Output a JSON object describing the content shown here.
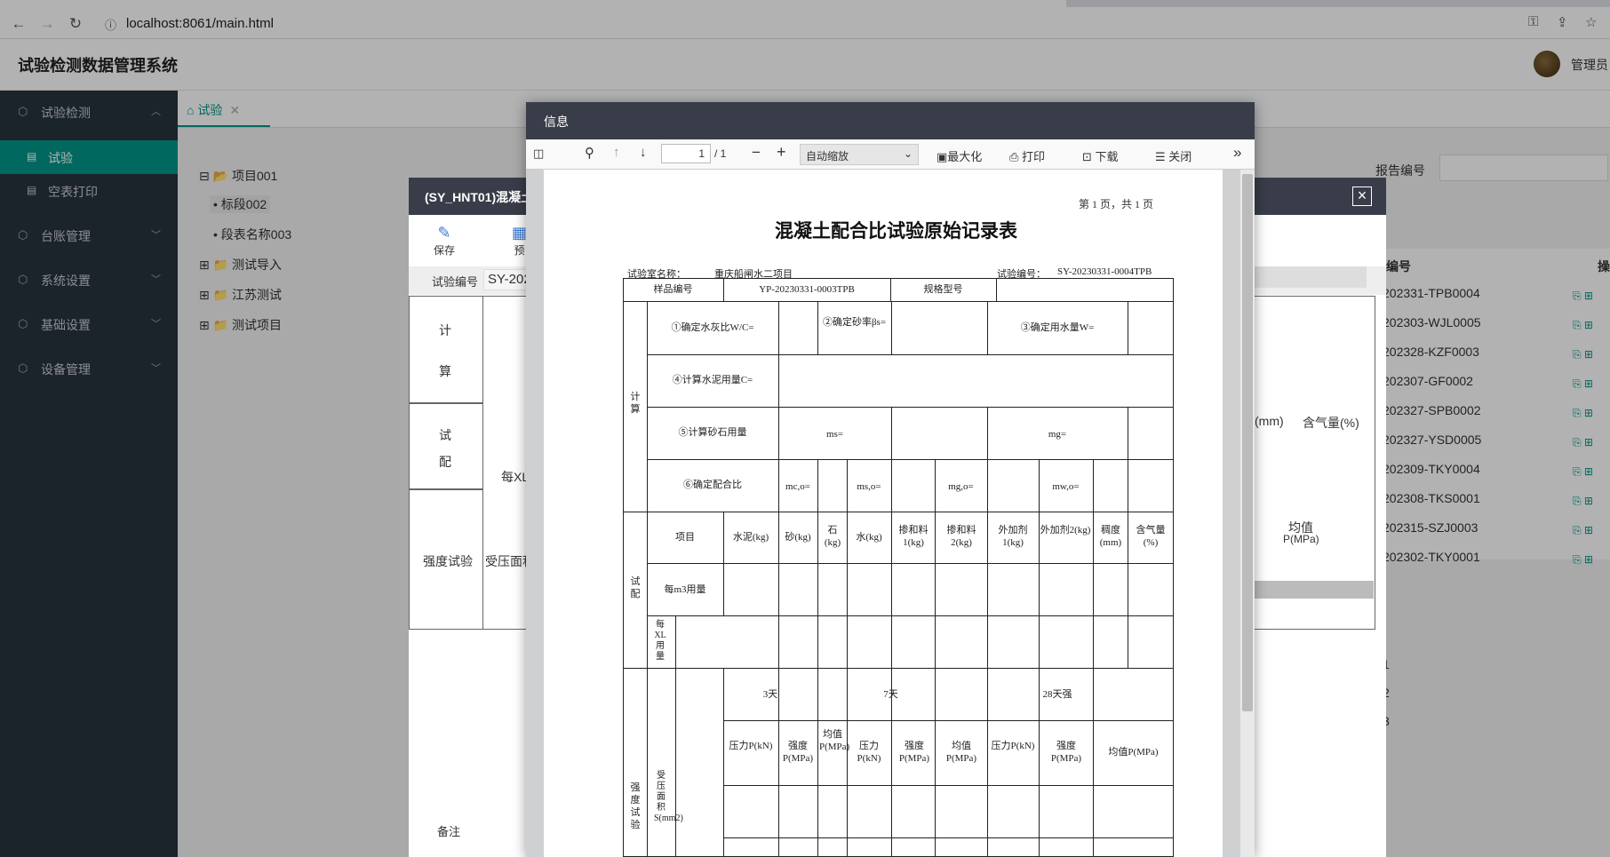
{
  "browser": {
    "url": "localhost:8061/main.html"
  },
  "header": {
    "title": "试验检测数据管理系统",
    "user": "管理员"
  },
  "sidebar": {
    "items": [
      {
        "label": "试验检测"
      },
      {
        "label": "台账管理"
      },
      {
        "label": "系统设置"
      },
      {
        "label": "基础设置"
      },
      {
        "label": "设备管理"
      }
    ],
    "sub": [
      {
        "label": "试验"
      },
      {
        "label": "空表打印"
      }
    ]
  },
  "content": {
    "tab": "试验",
    "tree": [
      "项目001",
      "标段002",
      "段表名称003",
      "测试导入",
      "江苏测试",
      "测试项目"
    ],
    "report_label": "报告编号",
    "col_no": "编号",
    "col_op": "操",
    "rows": [
      "202331-TPB0004",
      "202303-WJL0005",
      "202328-KZF0003",
      "202307-GF0002",
      "202327-SPB0002",
      "202327-YSD0005",
      "202309-TKY0004",
      "202308-TKS0001",
      "202315-SZJ0003",
      "202302-TKY0001"
    ],
    "right_vals": [
      "1",
      "2",
      "3"
    ]
  },
  "dialog": {
    "title": "(SY_HNT01)混凝土",
    "save": "保存",
    "preview": "预",
    "test_no_label": "试验编号",
    "test_no": "SY-202",
    "sec_calc_1": "计",
    "sec_calc_2": "算",
    "sec_mix_1": "试",
    "sec_mix_2": "配",
    "per_xl": "每XL",
    "strength": "强度试验",
    "pressure_area": "受压面积",
    "slump_mm": "(mm)",
    "air_content": "含气量(%)",
    "avg_p": "均值",
    "avg_p_unit": "P(MPa)",
    "remark": "备注"
  },
  "pdf": {
    "title": "信息",
    "page": "1",
    "page_total": "/ 1",
    "zoom": "自动缩放",
    "maximize": "最大化",
    "print": "打印",
    "download": "下载",
    "close": "关闭"
  },
  "form": {
    "pageno": "第 1 页，共 1 页",
    "title": "混凝土配合比试验原始记录表",
    "lab_label": "试验室名称：",
    "lab": "重庆船闸水二项目",
    "testno_label": "试验编号：",
    "testno": "SY-20230331-0004TPB",
    "sample_label": "样品编号",
    "sample": "YP-20230331-0003TPB",
    "spec_label": "规格型号",
    "calc": "计算",
    "r1a": "①确定水灰比W/C=",
    "r1b": "②确定砂率βs=",
    "r1c": "③确定用水量W=",
    "r2": "④计算水泥用量C=",
    "r3": "⑤计算砂石用量",
    "ms": "ms=",
    "mg": "mg=",
    "r4": "⑥确定配合比",
    "mc": "mc,o=",
    "ms0": "ms,o=",
    "mg0": "mg,o=",
    "mw0": "mw,o=",
    "trial": "试配",
    "item": "项目",
    "cement": "水泥(kg)",
    "sand": "砂(kg)",
    "stone": "石(kg)",
    "water": "水(kg)",
    "adm1": "掺和料1(kg)",
    "adm2": "掺和料2(kg)",
    "add1": "外加剂1(kg)",
    "add2": "外加剂2(kg)",
    "slump": "稠度(mm)",
    "air": "含气量(%)",
    "perm3": "每m3用量",
    "perxl": "每XL用量",
    "strength": "强度试验",
    "area": "受压面积S(mm2)",
    "d3": "3天",
    "d7": "7天",
    "d28": "28天强",
    "pkn": "压力P(kN)",
    "pmpa": "强度P(MPa)",
    "avg": "均值P(MPa)",
    "avg2": "均值P(MPa)"
  },
  "colors": {
    "accent": "#009688",
    "sidebar": "#28333e",
    "dialog_head": "#393d49"
  }
}
